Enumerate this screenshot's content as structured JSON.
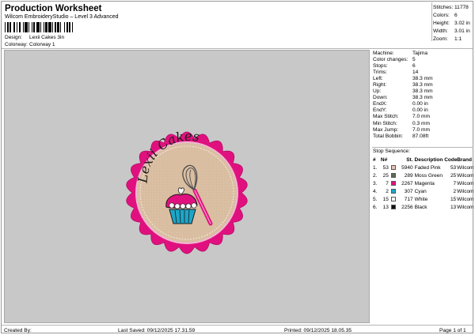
{
  "header": {
    "title": "Production Worksheet",
    "software": "Wilcom EmbroideryStudio – Level 3 Advanced",
    "design_label": "Design:",
    "design_value": "Lexii Cakes 3in",
    "colorway_label": "Colorway:",
    "colorway_value": "Colorway 1"
  },
  "stats": [
    {
      "label": "Stitches:",
      "value": "11778"
    },
    {
      "label": "Colors:",
      "value": "6"
    },
    {
      "label": "Height:",
      "value": "3.02 in"
    },
    {
      "label": "Width:",
      "value": "3.01 in"
    },
    {
      "label": "Zoom:",
      "value": "1:1"
    }
  ],
  "machine_info": [
    {
      "label": "Machine:",
      "value": "Tajima"
    },
    {
      "label": "Color changes:",
      "value": "5"
    },
    {
      "label": "Stops:",
      "value": "6"
    },
    {
      "label": "Trims:",
      "value": "14"
    },
    {
      "label": "Left:",
      "value": "38.3 mm"
    },
    {
      "label": "Right:",
      "value": "38.3 mm"
    },
    {
      "label": "Up:",
      "value": "38.3 mm"
    },
    {
      "label": "Down:",
      "value": "38.3 mm"
    },
    {
      "label": "EndX:",
      "value": "0.00 in"
    },
    {
      "label": "EndY:",
      "value": "0.00 in"
    },
    {
      "label": "Max Stitch:",
      "value": "7.0 mm"
    },
    {
      "label": "Min Stitch:",
      "value": "0.3 mm"
    },
    {
      "label": "Max Jump:",
      "value": "7.0 mm"
    },
    {
      "label": "Total Bobbin:",
      "value": "87.08ft"
    }
  ],
  "stop_sequence": {
    "title": "Stop Sequence:",
    "headers": {
      "num": "#",
      "n": "N#",
      "st": "St.",
      "desc": "Description",
      "code": "Code",
      "brand": "Brand"
    },
    "rows": [
      {
        "num": "1.",
        "n": "53",
        "color": "#E8C2B6",
        "st": "5940",
        "desc": "Faded Pink",
        "code": "53",
        "brand": "Wilcom"
      },
      {
        "num": "2.",
        "n": "25",
        "color": "#5F6A56",
        "st": "289",
        "desc": "Moss Green",
        "code": "25",
        "brand": "Wilcom"
      },
      {
        "num": "3.",
        "n": "7",
        "color": "#E0117F",
        "st": "2267",
        "desc": "Magenta",
        "code": "7",
        "brand": "Wilcom"
      },
      {
        "num": "4.",
        "n": "2",
        "color": "#1BA6C9",
        "st": "307",
        "desc": "Cyan",
        "code": "2",
        "brand": "Wilcom"
      },
      {
        "num": "5.",
        "n": "15",
        "color": "#FFFFFF",
        "st": "717",
        "desc": "White",
        "code": "15",
        "brand": "Wilcom"
      },
      {
        "num": "6.",
        "n": "13",
        "color": "#111111",
        "st": "2256",
        "desc": "Black",
        "code": "13",
        "brand": "Wilcom"
      }
    ]
  },
  "design_text": "Lexii Cakes",
  "colors": {
    "background": "#C8C8C8",
    "patch_fill": "#DCC1A6",
    "border_pink": "#E0117F"
  },
  "footer": {
    "created_by": "Created By:",
    "last_saved": "Last Saved: 09/12/2025 17.31.59",
    "printed": "Printed: 09/12/2025 18.05.35",
    "page": "Page 1 of 1"
  }
}
